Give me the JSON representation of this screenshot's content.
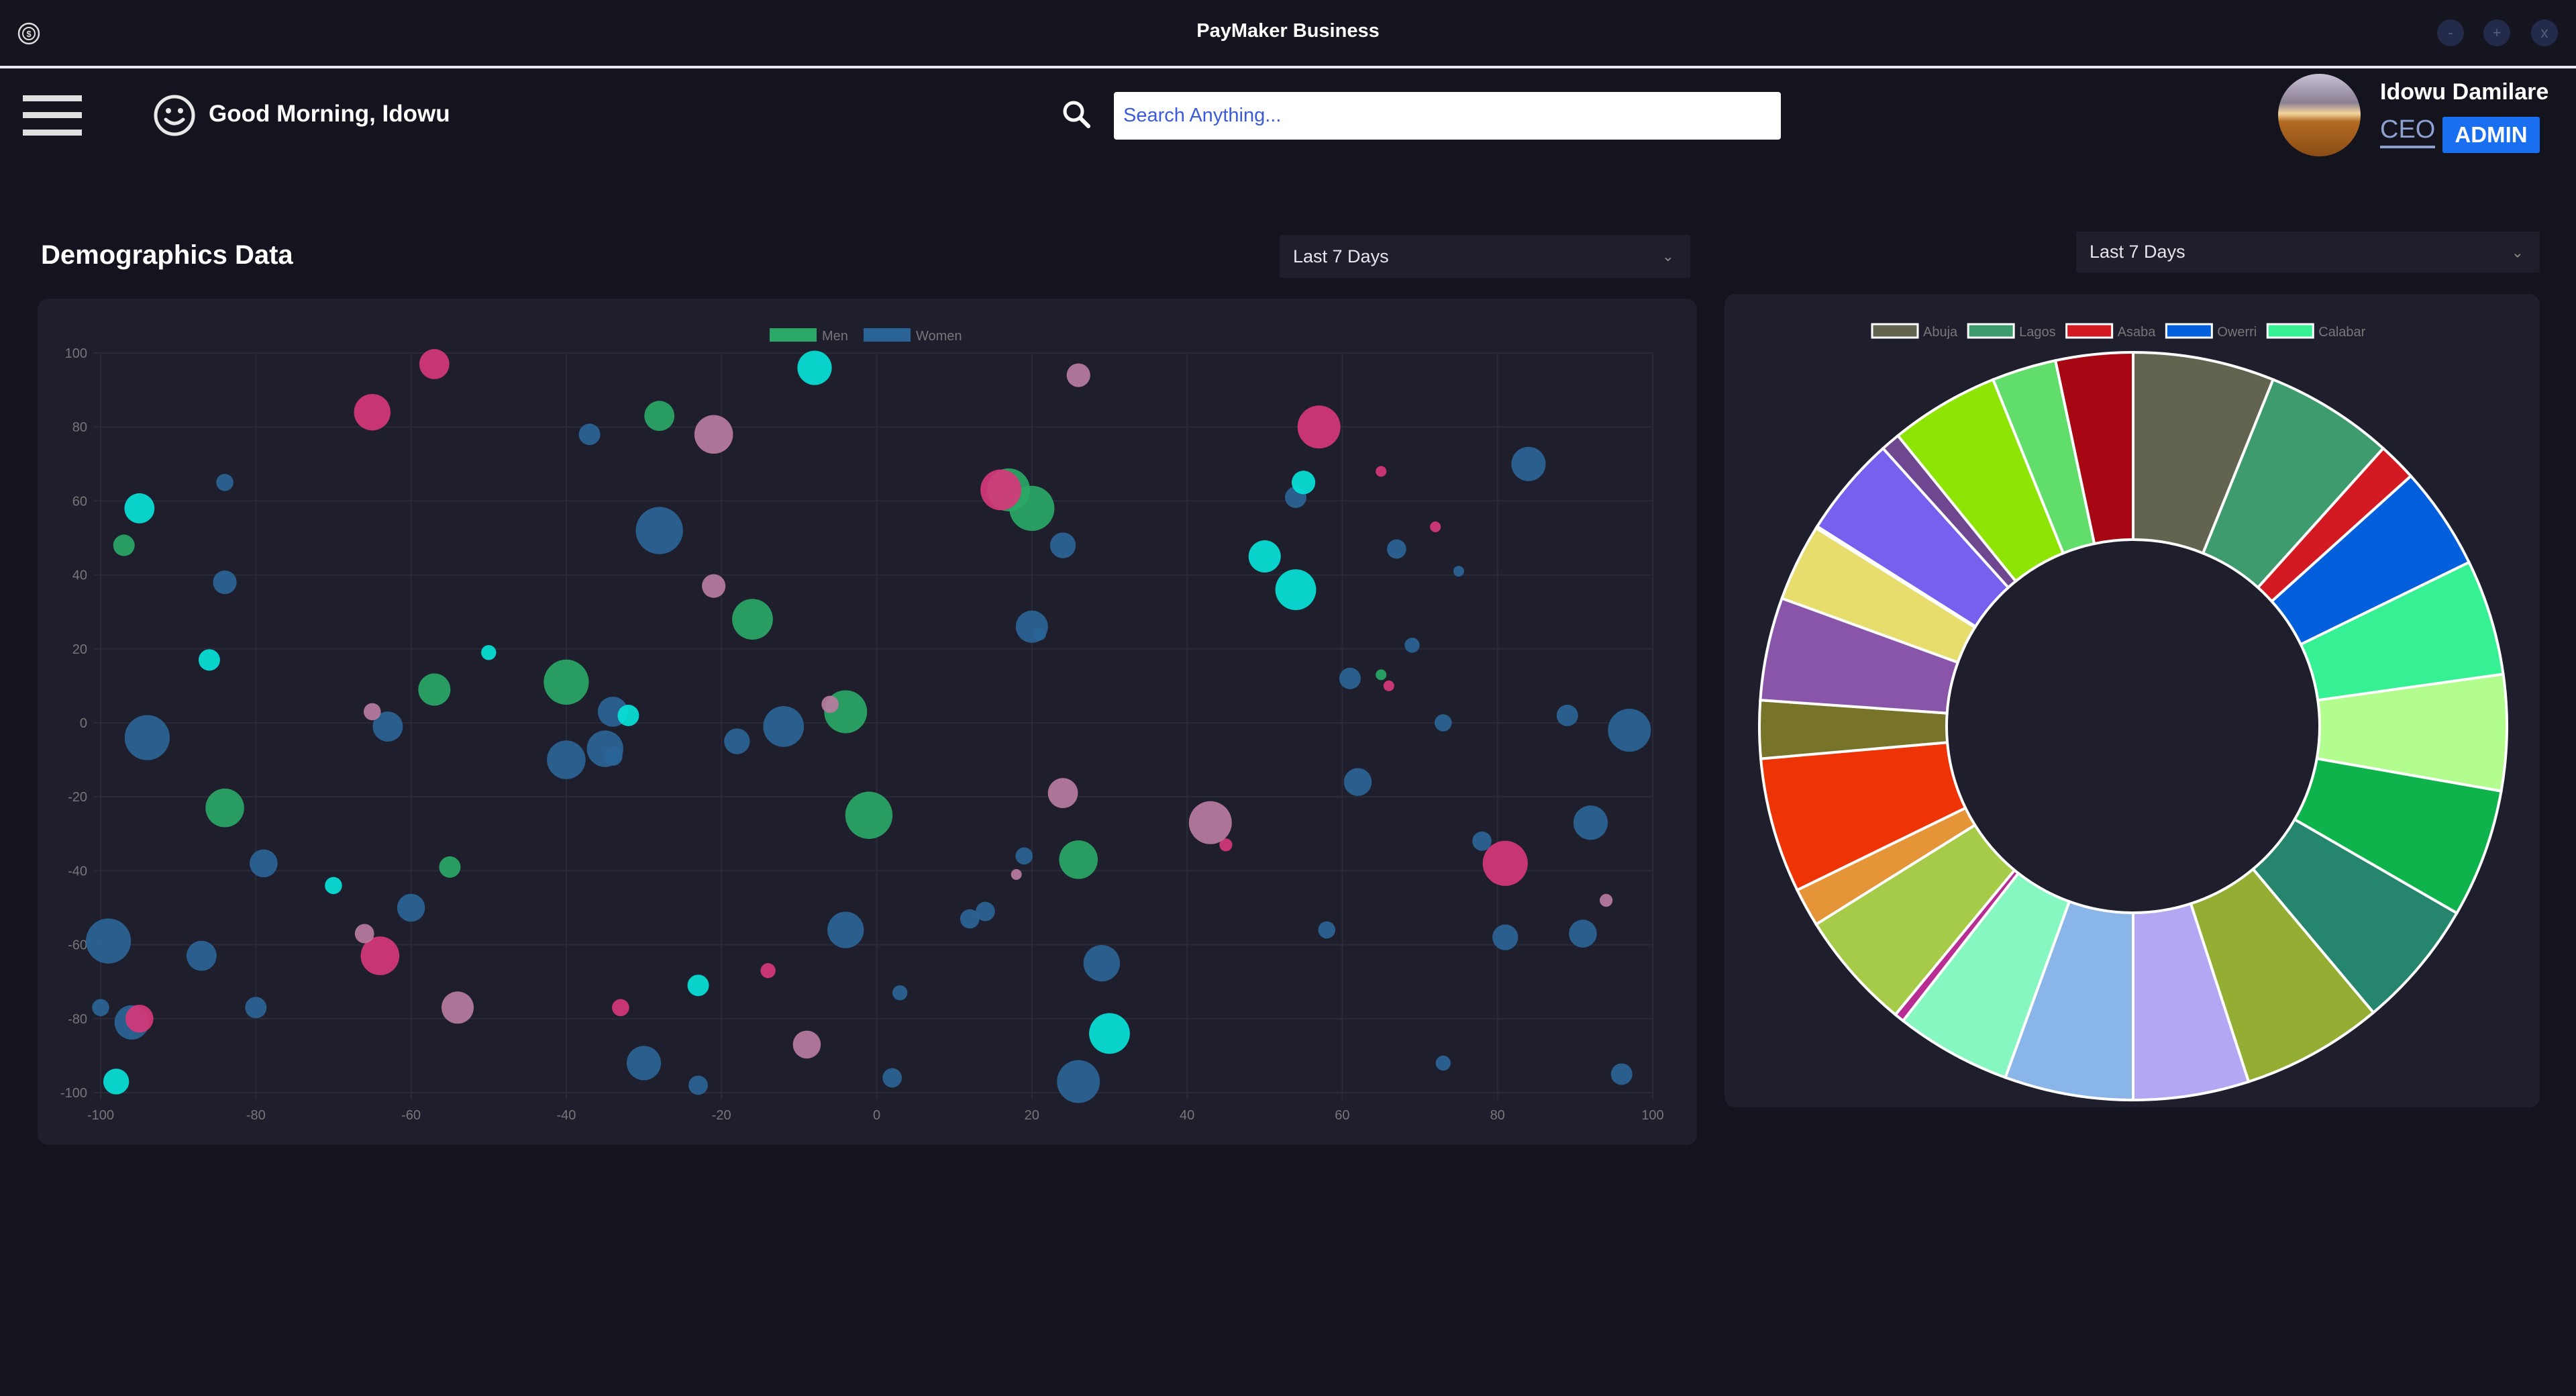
{
  "window": {
    "title": "PayMaker Business",
    "controls": {
      "minimize": "-",
      "maximize": "+",
      "close": "x"
    }
  },
  "header": {
    "greeting": "Good Morning, Idowu",
    "search": {
      "placeholder": "Search Anything...",
      "value": ""
    },
    "user": {
      "name": "Idowu Damilare",
      "role": "CEO",
      "badge": "ADMIN"
    }
  },
  "colors": {
    "accent": "#1a6ff0",
    "background": "#14141f",
    "card": "#1e1e2c"
  },
  "main": {
    "title": "Demographics Data",
    "left_filter": "Last 7 Days",
    "right_filter": "Last 7 Days"
  },
  "chart_data": [
    {
      "type": "scatter",
      "subtype": "bubble",
      "xlim": [
        -100,
        100
      ],
      "ylim": [
        -100,
        100
      ],
      "xticks": [
        -100,
        -80,
        -60,
        -40,
        -20,
        0,
        20,
        40,
        60,
        80,
        100
      ],
      "yticks": [
        100,
        80,
        60,
        40,
        20,
        0,
        -20,
        -40,
        -60,
        -80,
        -100
      ],
      "grid": true,
      "legend_position": "top",
      "legend": [
        "Men",
        "Women"
      ],
      "series": [
        {
          "name": "Men",
          "color": "#2aa866",
          "points": [
            [
              -28,
              83,
              14
            ],
            [
              -97,
              48,
              10
            ],
            [
              -16,
              28,
              19
            ],
            [
              -40,
              11,
              21
            ],
            [
              -57,
              9,
              15
            ],
            [
              -4,
              3,
              20
            ],
            [
              -84,
              -23,
              18
            ],
            [
              -1,
              -25,
              22
            ],
            [
              -55,
              -39,
              10
            ],
            [
              26,
              -37,
              18
            ],
            [
              17,
              63,
              20
            ],
            [
              20,
              58,
              21
            ],
            [
              65,
              13,
              5
            ]
          ]
        },
        {
          "name": "Women",
          "color": "#2a6496",
          "points": [
            [
              -37,
              78,
              10
            ],
            [
              -84,
              65,
              8
            ],
            [
              -28,
              52,
              22
            ],
            [
              -84,
              38,
              11
            ],
            [
              24,
              48,
              12
            ],
            [
              20,
              26,
              15
            ],
            [
              21,
              24,
              6
            ],
            [
              54,
              61,
              10
            ],
            [
              67,
              47,
              9
            ],
            [
              75,
              41,
              5
            ],
            [
              84,
              70,
              16
            ],
            [
              69,
              21,
              7
            ],
            [
              61,
              12,
              10
            ],
            [
              -94,
              -4,
              21
            ],
            [
              -63,
              -1,
              14
            ],
            [
              -34,
              3,
              14
            ],
            [
              -35,
              -7,
              17
            ],
            [
              -34,
              -9,
              9
            ],
            [
              -40,
              -10,
              18
            ],
            [
              -18,
              -5,
              12
            ],
            [
              -12,
              -1,
              19
            ],
            [
              73,
              0,
              8
            ],
            [
              89,
              2,
              10
            ],
            [
              97,
              -2,
              20
            ],
            [
              62,
              -16,
              13
            ],
            [
              92,
              -27,
              16
            ],
            [
              78,
              -32,
              9
            ],
            [
              -79,
              -38,
              13
            ],
            [
              19,
              -36,
              8
            ],
            [
              -60,
              -50,
              13
            ],
            [
              14,
              -51,
              9
            ],
            [
              12,
              -53,
              9
            ],
            [
              -99,
              -59,
              21
            ],
            [
              -4,
              -56,
              17
            ],
            [
              58,
              -56,
              8
            ],
            [
              81,
              -58,
              12
            ],
            [
              91,
              -57,
              13
            ],
            [
              -87,
              -63,
              14
            ],
            [
              29,
              -65,
              17
            ],
            [
              3,
              -73,
              7
            ],
            [
              -100,
              -77,
              8
            ],
            [
              -80,
              -77,
              10
            ],
            [
              -96,
              -81,
              16
            ],
            [
              -30,
              -92,
              16
            ],
            [
              -23,
              -98,
              9
            ],
            [
              2,
              -96,
              9
            ],
            [
              26,
              -97,
              20
            ],
            [
              73,
              -92,
              7
            ],
            [
              96,
              -95,
              10
            ]
          ]
        },
        {
          "color": "#06e2d8",
          "points": [
            [
              -8,
              96,
              16
            ],
            [
              -95,
              58,
              14
            ],
            [
              55,
              65,
              11
            ],
            [
              50,
              45,
              15
            ],
            [
              54,
              36,
              19
            ],
            [
              -86,
              17,
              10
            ],
            [
              -50,
              19,
              7
            ],
            [
              -32,
              2,
              10
            ],
            [
              -70,
              -44,
              8
            ],
            [
              -23,
              -71,
              10
            ],
            [
              30,
              -84,
              19
            ],
            [
              -98,
              -97,
              12
            ]
          ]
        },
        {
          "color": "#d6387a",
          "points": [
            [
              -57,
              97,
              14
            ],
            [
              -65,
              84,
              17
            ],
            [
              57,
              80,
              20
            ],
            [
              16,
              63,
              19
            ],
            [
              65,
              68,
              5
            ],
            [
              72,
              53,
              5
            ],
            [
              66,
              10,
              5
            ],
            [
              45,
              -33,
              6
            ],
            [
              81,
              -38,
              21
            ],
            [
              -64,
              -63,
              18
            ],
            [
              -14,
              -67,
              7
            ],
            [
              -33,
              -77,
              8
            ],
            [
              -95,
              -80,
              13
            ]
          ]
        },
        {
          "color": "#b97c9f",
          "points": [
            [
              26,
              94,
              11
            ],
            [
              -21,
              78,
              18
            ],
            [
              -21,
              37,
              11
            ],
            [
              -65,
              3,
              8
            ],
            [
              -6,
              5,
              8
            ],
            [
              24,
              -19,
              14
            ],
            [
              43,
              -27,
              20
            ],
            [
              18,
              -41,
              5
            ],
            [
              94,
              -48,
              6
            ],
            [
              -66,
              -57,
              9
            ],
            [
              -54,
              -77,
              15
            ],
            [
              -9,
              -87,
              13
            ]
          ]
        }
      ]
    },
    {
      "type": "pie",
      "subtype": "doughnut",
      "legend_position": "top",
      "labels": [
        "Abuja",
        "Lagos",
        "Asaba",
        "Owerri",
        "Calabar"
      ],
      "values": [
        22,
        20,
        6,
        16,
        18,
        18,
        20,
        20,
        22,
        18,
        20,
        18,
        1.5,
        18.5,
        6,
        21,
        9,
        16,
        12,
        0.3,
        15.7,
        3,
        17,
        10,
        12
      ],
      "colors": [
        "#636450",
        "#3d9b6e",
        "#d31a22",
        "#045fdd",
        "#35f193",
        "#b3fd8f",
        "#0fb34b",
        "#26866d",
        "#93ae33",
        "#b3a6f2",
        "#8ab5e8",
        "#87f7c1",
        "#b82d92",
        "#a6cb48",
        "#e59538",
        "#ee3407",
        "#777429",
        "#8955a8",
        "#e7dd6d",
        "#ff0000",
        "#7660ed",
        "#6f4690",
        "#8de405",
        "#61dd6b",
        "#a60713"
      ]
    }
  ]
}
